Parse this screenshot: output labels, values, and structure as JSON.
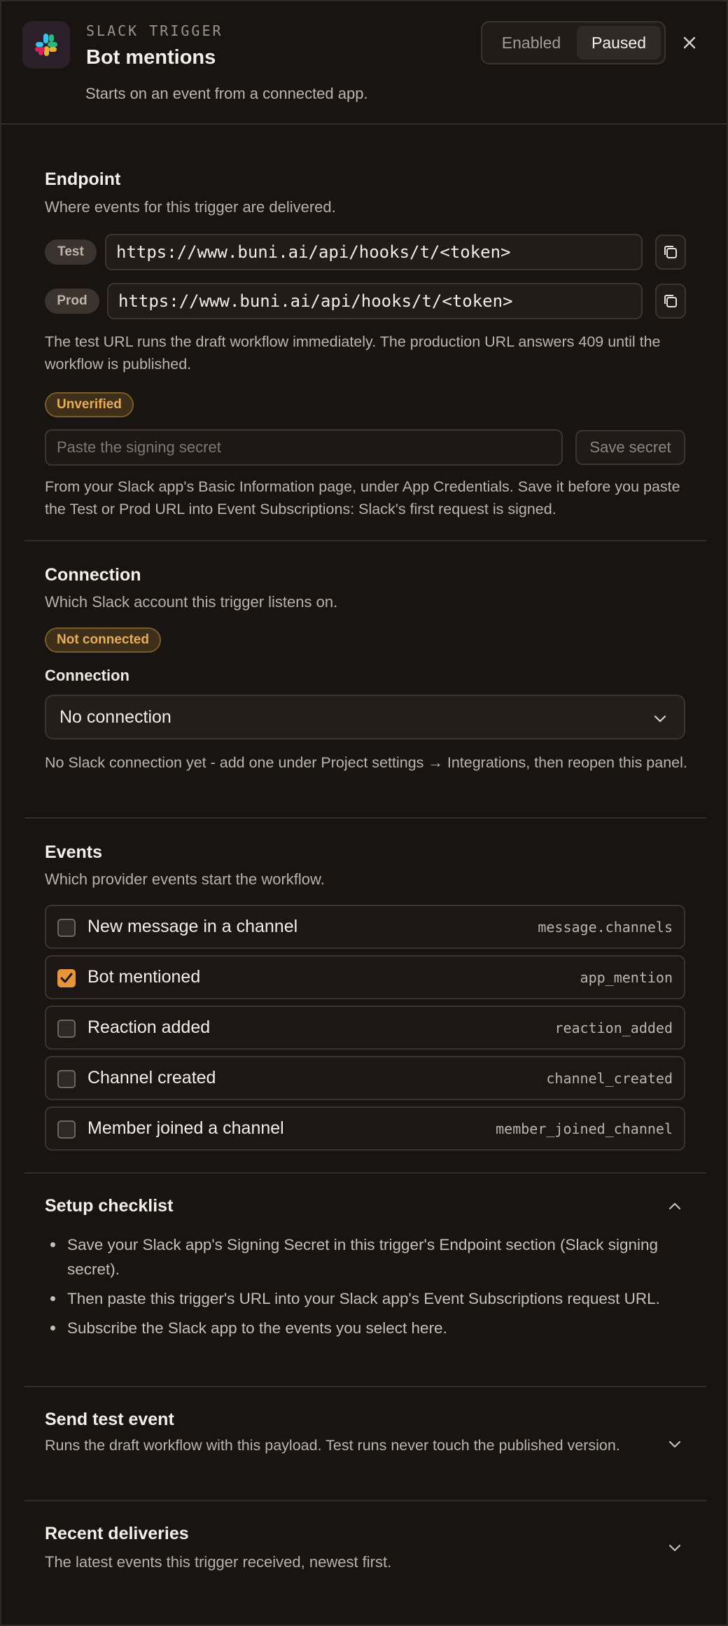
{
  "header": {
    "eyebrow": "SLACK TRIGGER",
    "title": "Bot mentions",
    "subtitle": "Starts on an event from a connected app.",
    "toggle": {
      "options": [
        "Enabled",
        "Paused"
      ],
      "selected": "Paused"
    }
  },
  "endpoint": {
    "title": "Endpoint",
    "description": "Where events for this trigger are delivered.",
    "test_label": "Test",
    "test_url": "https://www.buni.ai/api/hooks/t/<token>",
    "prod_label": "Prod",
    "prod_url": "https://www.buni.ai/api/hooks/t/<token>",
    "url_note": "The test URL runs the draft workflow immediately. The production URL answers 409 until the workflow is published.",
    "status_badge": "Unverified",
    "secret_placeholder": "Paste the signing secret",
    "save_secret_label": "Save secret",
    "secret_note": "From your Slack app's Basic Information page, under App Credentials. Save it before you paste the Test or Prod URL into Event Subscriptions: Slack's first request is signed."
  },
  "connection": {
    "title": "Connection",
    "description": "Which Slack account this trigger listens on.",
    "status_badge": "Not connected",
    "field_label": "Connection",
    "selected": "No connection",
    "note": "No Slack connection yet - add one under Project settings → Integrations, then reopen this panel."
  },
  "events": {
    "title": "Events",
    "description": "Which provider events start the workflow.",
    "items": [
      {
        "label": "New message in a channel",
        "code": "message.channels",
        "checked": false
      },
      {
        "label": "Bot mentioned",
        "code": "app_mention",
        "checked": true
      },
      {
        "label": "Reaction added",
        "code": "reaction_added",
        "checked": false
      },
      {
        "label": "Channel created",
        "code": "channel_created",
        "checked": false
      },
      {
        "label": "Member joined a channel",
        "code": "member_joined_channel",
        "checked": false
      }
    ]
  },
  "checklist": {
    "title": "Setup checklist",
    "expanded": true,
    "items": [
      "Save your Slack app's Signing Secret in this trigger's Endpoint section (Slack signing secret).",
      "Then paste this trigger's URL into your Slack app's Event Subscriptions request URL.",
      "Subscribe the Slack app to the events you select here."
    ]
  },
  "send_test": {
    "title": "Send test event",
    "description": "Runs the draft workflow with this payload. Test runs never touch the published version.",
    "expanded": false
  },
  "recent": {
    "title": "Recent deliveries",
    "description": "The latest events this trigger received, newest first.",
    "expanded": false
  },
  "colors": {
    "background": "#181412",
    "accent": "#e8953a",
    "badge_text": "#e8ad55"
  }
}
